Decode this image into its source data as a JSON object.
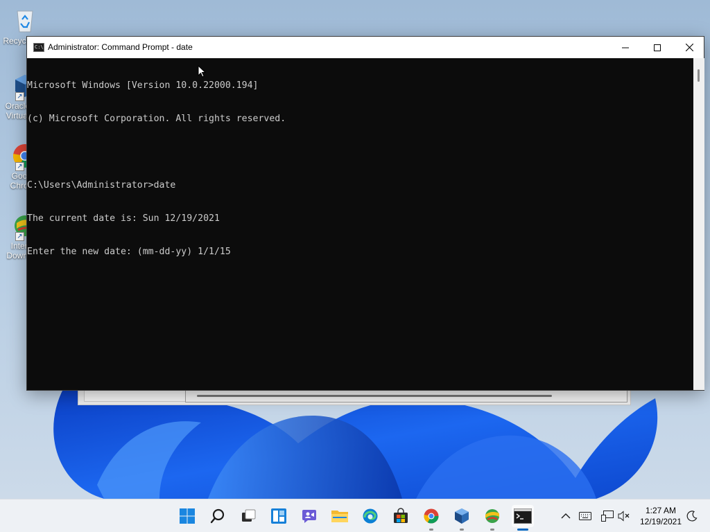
{
  "desktop": {
    "icons": [
      {
        "label": "Recycle Bin",
        "icon": "recycle-bin-icon"
      },
      {
        "label": "Oracle VM VirtualBox",
        "icon": "virtualbox-icon"
      },
      {
        "label": "Google Chrome",
        "icon": "chrome-icon"
      },
      {
        "label": "Internet Download Manager",
        "icon": "idm-icon"
      }
    ]
  },
  "window": {
    "title": "Administrator: Command Prompt - date",
    "icon": "cmd-icon",
    "buttons": {
      "minimize": "minimize-icon",
      "maximize": "maximize-icon",
      "close": "close-icon"
    }
  },
  "console": {
    "lines": [
      "Microsoft Windows [Version 10.0.22000.194]",
      "(c) Microsoft Corporation. All rights reserved.",
      "",
      "C:\\Users\\Administrator>date",
      "The current date is: Sun 12/19/2021",
      "Enter the new date: (mm-dd-yy) 1/1/15"
    ],
    "text_color": "#cccccc",
    "background": "#0c0c0c"
  },
  "taskbar": {
    "apps": [
      {
        "name": "Start",
        "icon": "windows-start-icon",
        "running": false,
        "active": false
      },
      {
        "name": "Search",
        "icon": "search-icon",
        "running": false,
        "active": false
      },
      {
        "name": "Task View",
        "icon": "task-view-icon",
        "running": false,
        "active": false
      },
      {
        "name": "Widgets",
        "icon": "widgets-icon",
        "running": false,
        "active": false
      },
      {
        "name": "Chat",
        "icon": "chat-icon",
        "running": false,
        "active": false
      },
      {
        "name": "File Explorer",
        "icon": "folder-icon",
        "running": false,
        "active": false
      },
      {
        "name": "Microsoft Edge",
        "icon": "edge-icon",
        "running": false,
        "active": false
      },
      {
        "name": "Microsoft Store",
        "icon": "store-icon",
        "running": false,
        "active": false
      },
      {
        "name": "Google Chrome",
        "icon": "chrome-icon",
        "running": true,
        "active": false
      },
      {
        "name": "VirtualBox",
        "icon": "virtualbox-icon",
        "running": true,
        "active": false
      },
      {
        "name": "Internet Download Manager",
        "icon": "idm-icon",
        "running": true,
        "active": false
      },
      {
        "name": "Command Prompt",
        "icon": "cmd-icon",
        "running": true,
        "active": true
      }
    ],
    "tray": {
      "icons": [
        "chevron-up-icon",
        "keyboard-icon",
        "network-icon",
        "volume-muted-icon"
      ],
      "time": "1:27 AM",
      "date": "12/19/2021",
      "notification_icon": "moon-icon"
    }
  },
  "colors": {
    "accent": "#0067c0",
    "wallpaper": "#1d5fd9"
  }
}
